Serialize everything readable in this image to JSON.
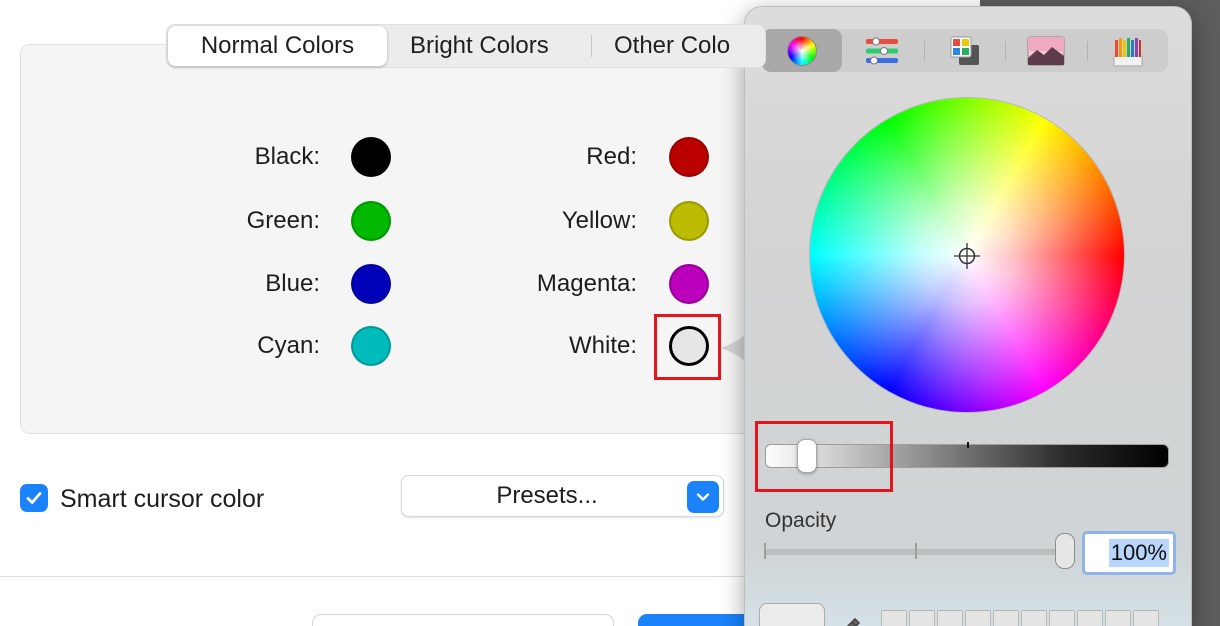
{
  "tabs": [
    {
      "label": "Normal Colors",
      "active": true
    },
    {
      "label": "Bright Colors",
      "active": false
    },
    {
      "label": "Other Colo",
      "active": false
    }
  ],
  "colors_left": [
    {
      "label": "Black:",
      "color": "#000000"
    },
    {
      "label": "Green:",
      "color": "#00b800"
    },
    {
      "label": "Blue:",
      "color": "#0000bb"
    },
    {
      "label": "Cyan:",
      "color": "#00bbbb"
    }
  ],
  "colors_right": [
    {
      "label": "Red:",
      "color": "#bb0000"
    },
    {
      "label": "Yellow:",
      "color": "#bbbb00"
    },
    {
      "label": "Magenta:",
      "color": "#bb00bb"
    },
    {
      "label": "White:",
      "color": "#e6e6e6"
    }
  ],
  "smart_cursor": {
    "label": "Smart cursor color",
    "checked": true
  },
  "presets": {
    "label": "Presets..."
  },
  "picker": {
    "tools": [
      "color-wheel-icon",
      "color-sliders-icon",
      "color-palettes-icon",
      "image-palettes-icon",
      "crayons-icon"
    ],
    "active_tool": "color-wheel-icon",
    "brightness_fraction": 0.1,
    "opacity_label": "Opacity",
    "opacity_value": "100%",
    "accent": "#1a82fb",
    "highlight": "#e4161b"
  }
}
